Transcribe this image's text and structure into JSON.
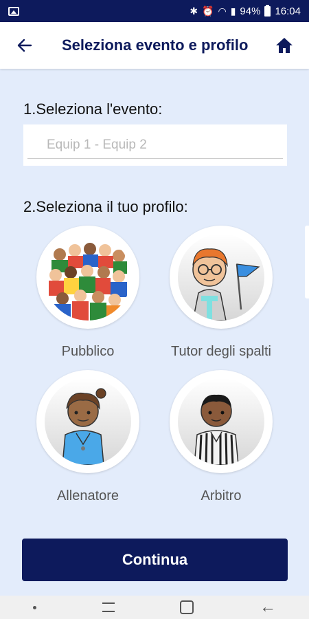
{
  "status_bar": {
    "battery": "94%",
    "time": "16:04"
  },
  "app_bar": {
    "title": "Seleziona evento e profilo"
  },
  "event": {
    "label": "1.Seleziona l'evento:",
    "placeholder": "Equip 1 - Equip 2",
    "value": ""
  },
  "profile": {
    "label": "2.Seleziona il tuo profilo:",
    "options": [
      {
        "label": "Pubblico"
      },
      {
        "label": "Tutor degli spalti"
      },
      {
        "label": "Allenatore"
      },
      {
        "label": "Arbitro"
      }
    ]
  },
  "actions": {
    "continue_label": "Continua"
  },
  "colors": {
    "primary": "#0d1a5c",
    "background": "#e3ecfb"
  }
}
